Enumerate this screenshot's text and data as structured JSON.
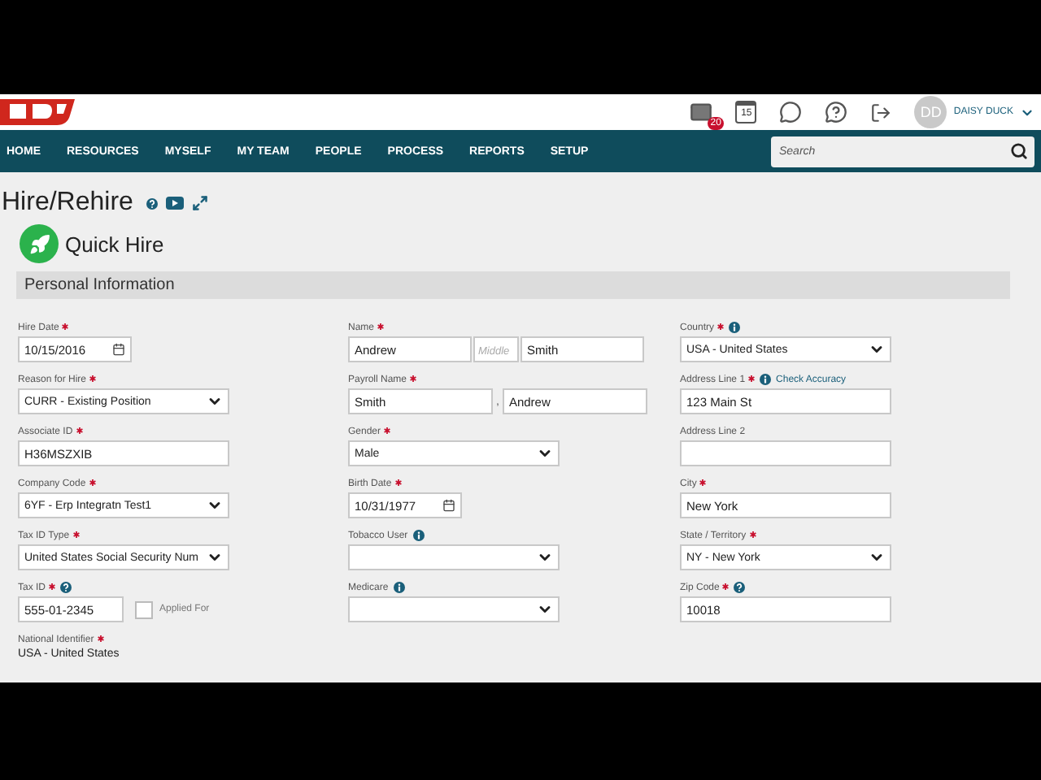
{
  "header": {
    "mail_badge": "20",
    "calendar_day": "15",
    "user_initials": "DD",
    "user_name": "DAISY DUCK"
  },
  "nav": {
    "items": [
      {
        "label": "HOME"
      },
      {
        "label": "RESOURCES"
      },
      {
        "label": "MYSELF"
      },
      {
        "label": "MY TEAM"
      },
      {
        "label": "PEOPLE"
      },
      {
        "label": "PROCESS"
      },
      {
        "label": "REPORTS"
      },
      {
        "label": "SETUP"
      }
    ],
    "search": {
      "placeholder": "Search"
    }
  },
  "page": {
    "title": "Hire/Rehire",
    "subtitle": "Quick Hire",
    "section": "Personal Information"
  },
  "columns": [
    [
      {
        "kind": "date",
        "label": "Hire Date",
        "required": true,
        "value": "10/15/2016"
      },
      {
        "kind": "select",
        "label": "Reason for Hire",
        "required": true,
        "value": "CURR - Existing Position"
      },
      {
        "kind": "text",
        "label": "Associate ID",
        "required": true,
        "value": "H36MSZXIB"
      },
      {
        "kind": "select",
        "label": "Company Code",
        "required": true,
        "value": "6YF - Erp Integratn Test1"
      },
      {
        "kind": "select",
        "label": "Tax ID Type",
        "required": true,
        "value": "United States Social Security Num"
      },
      {
        "kind": "text-check",
        "label": "Tax ID",
        "required": true,
        "help": true,
        "value": "555-01-2345",
        "check_label": "Applied For",
        "checked": false
      },
      {
        "kind": "static",
        "label": "National Identifier",
        "required": true,
        "value": "USA - United States"
      }
    ],
    [
      {
        "kind": "name",
        "label": "Name",
        "required": true,
        "first": "Andrew",
        "middle_placeholder": "Middle",
        "last": "Smith"
      },
      {
        "kind": "pair",
        "label": "Payroll Name",
        "required": true,
        "parts": [
          "Smith",
          "Andrew"
        ],
        "separator": ","
      },
      {
        "kind": "select",
        "label": "Gender",
        "required": true,
        "value": "Male"
      },
      {
        "kind": "date",
        "label": "Birth Date",
        "required": true,
        "value": "10/31/1977"
      },
      {
        "kind": "select",
        "label": "Tobacco User",
        "required": false,
        "info": true
      },
      {
        "kind": "select",
        "label": "Medicare",
        "required": false,
        "info": true
      }
    ],
    [
      {
        "kind": "select",
        "label": "Country",
        "required": true,
        "info": true,
        "value": "USA - United States"
      },
      {
        "kind": "text",
        "label": "Address Line 1",
        "required": true,
        "info": true,
        "link": "Check Accuracy",
        "value": "123 Main St"
      },
      {
        "kind": "text",
        "label": "Address Line 2",
        "required": false
      },
      {
        "kind": "text",
        "label": "City",
        "required": true,
        "value": "New York"
      },
      {
        "kind": "select",
        "label": "State / Territory",
        "required": true,
        "value": "NY - New York"
      },
      {
        "kind": "text",
        "label": "Zip Code",
        "required": true,
        "help": true,
        "value": "10018"
      }
    ]
  ]
}
